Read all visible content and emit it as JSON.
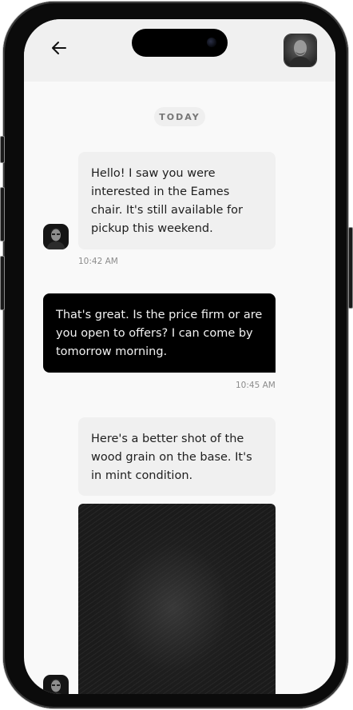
{
  "status_bar": {},
  "header": {
    "back_icon": "arrow-left-icon",
    "contact_avatar": "avatar-photo"
  },
  "date_separator": "TODAY",
  "messages": [
    {
      "direction": "incoming",
      "text": "Hello! I saw you were interested in the Eames chair. It's still available for pickup this weekend.",
      "time": "10:42 AM"
    },
    {
      "direction": "outgoing",
      "text": "That's great. Is the price firm or are you open to offers? I can come by tomorrow morning.",
      "time": "10:45 AM"
    },
    {
      "direction": "incoming",
      "text": "Here's a better shot of the wood grain on the base. It's in mint condition.",
      "attachment": "photo"
    }
  ],
  "colors": {
    "screen_bg": "#f9f9f9",
    "header_bg": "#f0f0f0",
    "incoming_bubble": "#f0f0f0",
    "outgoing_bubble": "#000000",
    "timestamp": "#8c8c8c"
  }
}
